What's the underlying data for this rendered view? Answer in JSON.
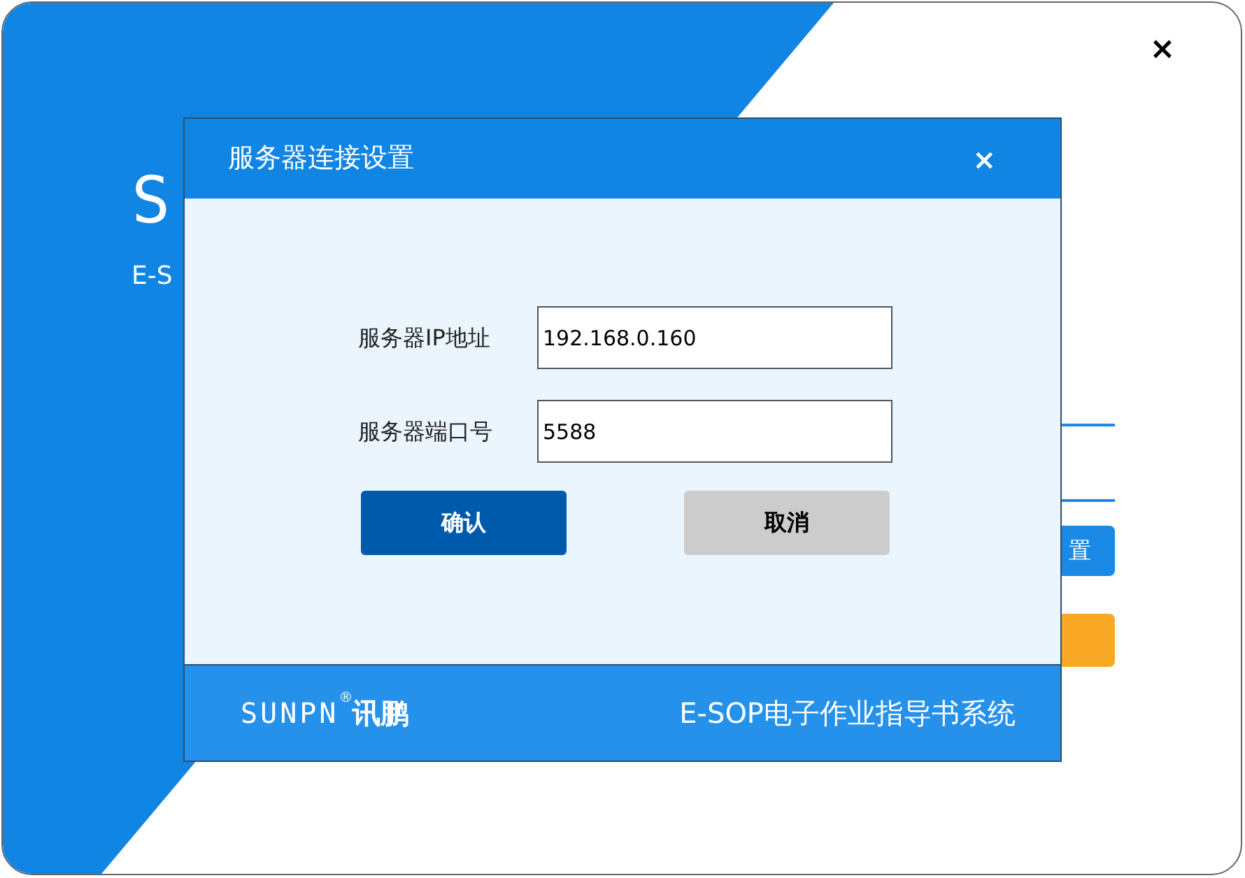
{
  "background": {
    "logo": "S",
    "subtitle": "E-S",
    "button_1": "置"
  },
  "dialog": {
    "title": "服务器连接设置",
    "close": "×",
    "fields": [
      {
        "label": "服务器IP地址",
        "value": "192.168.0.160"
      },
      {
        "label": "服务器端口号",
        "value": "5588"
      }
    ],
    "buttons": [
      {
        "label": "确认",
        "kind": "primary"
      },
      {
        "label": "取消",
        "kind": "secondary"
      }
    ],
    "footer": {
      "brand": "SUNPN",
      "brand_mark": "®",
      "brand_cn": "讯鹏",
      "title": "E-SOP电子作业指导书系统"
    }
  },
  "window": {
    "close": "×"
  }
}
